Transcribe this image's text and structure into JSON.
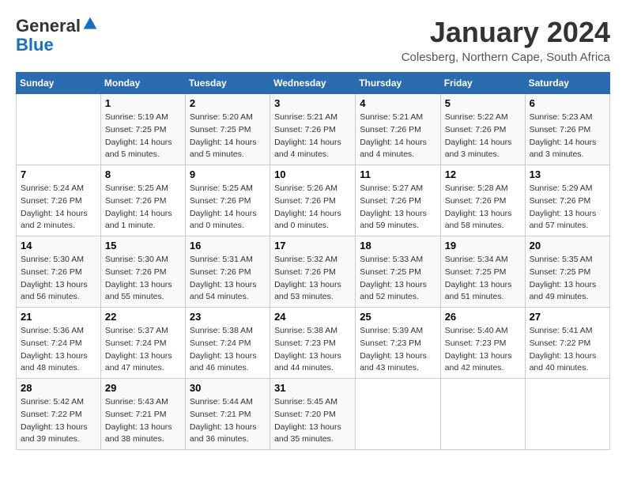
{
  "logo": {
    "general": "General",
    "blue": "Blue"
  },
  "title": "January 2024",
  "location": "Colesberg, Northern Cape, South Africa",
  "days_header": [
    "Sunday",
    "Monday",
    "Tuesday",
    "Wednesday",
    "Thursday",
    "Friday",
    "Saturday"
  ],
  "weeks": [
    [
      {
        "day": "",
        "info": ""
      },
      {
        "day": "1",
        "info": "Sunrise: 5:19 AM\nSunset: 7:25 PM\nDaylight: 14 hours\nand 5 minutes."
      },
      {
        "day": "2",
        "info": "Sunrise: 5:20 AM\nSunset: 7:25 PM\nDaylight: 14 hours\nand 5 minutes."
      },
      {
        "day": "3",
        "info": "Sunrise: 5:21 AM\nSunset: 7:26 PM\nDaylight: 14 hours\nand 4 minutes."
      },
      {
        "day": "4",
        "info": "Sunrise: 5:21 AM\nSunset: 7:26 PM\nDaylight: 14 hours\nand 4 minutes."
      },
      {
        "day": "5",
        "info": "Sunrise: 5:22 AM\nSunset: 7:26 PM\nDaylight: 14 hours\nand 3 minutes."
      },
      {
        "day": "6",
        "info": "Sunrise: 5:23 AM\nSunset: 7:26 PM\nDaylight: 14 hours\nand 3 minutes."
      }
    ],
    [
      {
        "day": "7",
        "info": "Sunrise: 5:24 AM\nSunset: 7:26 PM\nDaylight: 14 hours\nand 2 minutes."
      },
      {
        "day": "8",
        "info": "Sunrise: 5:25 AM\nSunset: 7:26 PM\nDaylight: 14 hours\nand 1 minute."
      },
      {
        "day": "9",
        "info": "Sunrise: 5:25 AM\nSunset: 7:26 PM\nDaylight: 14 hours\nand 0 minutes."
      },
      {
        "day": "10",
        "info": "Sunrise: 5:26 AM\nSunset: 7:26 PM\nDaylight: 14 hours\nand 0 minutes."
      },
      {
        "day": "11",
        "info": "Sunrise: 5:27 AM\nSunset: 7:26 PM\nDaylight: 13 hours\nand 59 minutes."
      },
      {
        "day": "12",
        "info": "Sunrise: 5:28 AM\nSunset: 7:26 PM\nDaylight: 13 hours\nand 58 minutes."
      },
      {
        "day": "13",
        "info": "Sunrise: 5:29 AM\nSunset: 7:26 PM\nDaylight: 13 hours\nand 57 minutes."
      }
    ],
    [
      {
        "day": "14",
        "info": "Sunrise: 5:30 AM\nSunset: 7:26 PM\nDaylight: 13 hours\nand 56 minutes."
      },
      {
        "day": "15",
        "info": "Sunrise: 5:30 AM\nSunset: 7:26 PM\nDaylight: 13 hours\nand 55 minutes."
      },
      {
        "day": "16",
        "info": "Sunrise: 5:31 AM\nSunset: 7:26 PM\nDaylight: 13 hours\nand 54 minutes."
      },
      {
        "day": "17",
        "info": "Sunrise: 5:32 AM\nSunset: 7:26 PM\nDaylight: 13 hours\nand 53 minutes."
      },
      {
        "day": "18",
        "info": "Sunrise: 5:33 AM\nSunset: 7:25 PM\nDaylight: 13 hours\nand 52 minutes."
      },
      {
        "day": "19",
        "info": "Sunrise: 5:34 AM\nSunset: 7:25 PM\nDaylight: 13 hours\nand 51 minutes."
      },
      {
        "day": "20",
        "info": "Sunrise: 5:35 AM\nSunset: 7:25 PM\nDaylight: 13 hours\nand 49 minutes."
      }
    ],
    [
      {
        "day": "21",
        "info": "Sunrise: 5:36 AM\nSunset: 7:24 PM\nDaylight: 13 hours\nand 48 minutes."
      },
      {
        "day": "22",
        "info": "Sunrise: 5:37 AM\nSunset: 7:24 PM\nDaylight: 13 hours\nand 47 minutes."
      },
      {
        "day": "23",
        "info": "Sunrise: 5:38 AM\nSunset: 7:24 PM\nDaylight: 13 hours\nand 46 minutes."
      },
      {
        "day": "24",
        "info": "Sunrise: 5:38 AM\nSunset: 7:23 PM\nDaylight: 13 hours\nand 44 minutes."
      },
      {
        "day": "25",
        "info": "Sunrise: 5:39 AM\nSunset: 7:23 PM\nDaylight: 13 hours\nand 43 minutes."
      },
      {
        "day": "26",
        "info": "Sunrise: 5:40 AM\nSunset: 7:23 PM\nDaylight: 13 hours\nand 42 minutes."
      },
      {
        "day": "27",
        "info": "Sunrise: 5:41 AM\nSunset: 7:22 PM\nDaylight: 13 hours\nand 40 minutes."
      }
    ],
    [
      {
        "day": "28",
        "info": "Sunrise: 5:42 AM\nSunset: 7:22 PM\nDaylight: 13 hours\nand 39 minutes."
      },
      {
        "day": "29",
        "info": "Sunrise: 5:43 AM\nSunset: 7:21 PM\nDaylight: 13 hours\nand 38 minutes."
      },
      {
        "day": "30",
        "info": "Sunrise: 5:44 AM\nSunset: 7:21 PM\nDaylight: 13 hours\nand 36 minutes."
      },
      {
        "day": "31",
        "info": "Sunrise: 5:45 AM\nSunset: 7:20 PM\nDaylight: 13 hours\nand 35 minutes."
      },
      {
        "day": "",
        "info": ""
      },
      {
        "day": "",
        "info": ""
      },
      {
        "day": "",
        "info": ""
      }
    ]
  ]
}
